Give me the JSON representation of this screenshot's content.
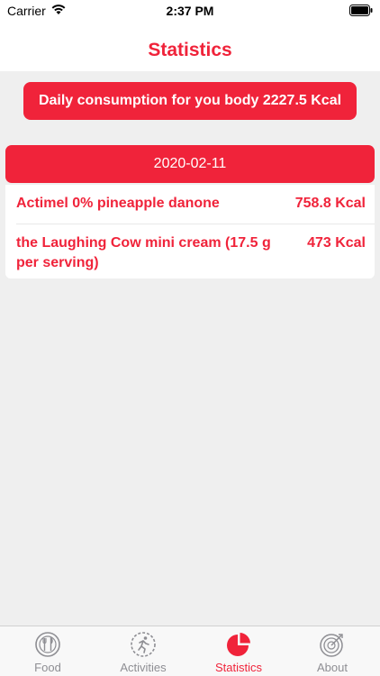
{
  "status_bar": {
    "carrier": "Carrier",
    "time": "2:37 PM"
  },
  "header": {
    "title": "Statistics"
  },
  "daily_banner": "Daily consumption for you body 2227.5 Kcal",
  "date_group": {
    "date": "2020-02-11",
    "items": [
      {
        "name": "Actimel 0% pineapple danone",
        "kcal": "758.8 Kcal"
      },
      {
        "name": "the Laughing Cow mini cream (17.5 g per serving)",
        "kcal": "473 Kcal"
      }
    ]
  },
  "tabbar": {
    "tabs": [
      {
        "label": "Food",
        "icon": "food-plate-icon"
      },
      {
        "label": "Activities",
        "icon": "running-icon"
      },
      {
        "label": "Statistics",
        "icon": "pie-chart-icon"
      },
      {
        "label": "About",
        "icon": "target-icon"
      }
    ],
    "active": "Statistics"
  },
  "colors": {
    "accent": "#f0233a",
    "background": "#efefef",
    "inactive": "#8e8e93"
  }
}
